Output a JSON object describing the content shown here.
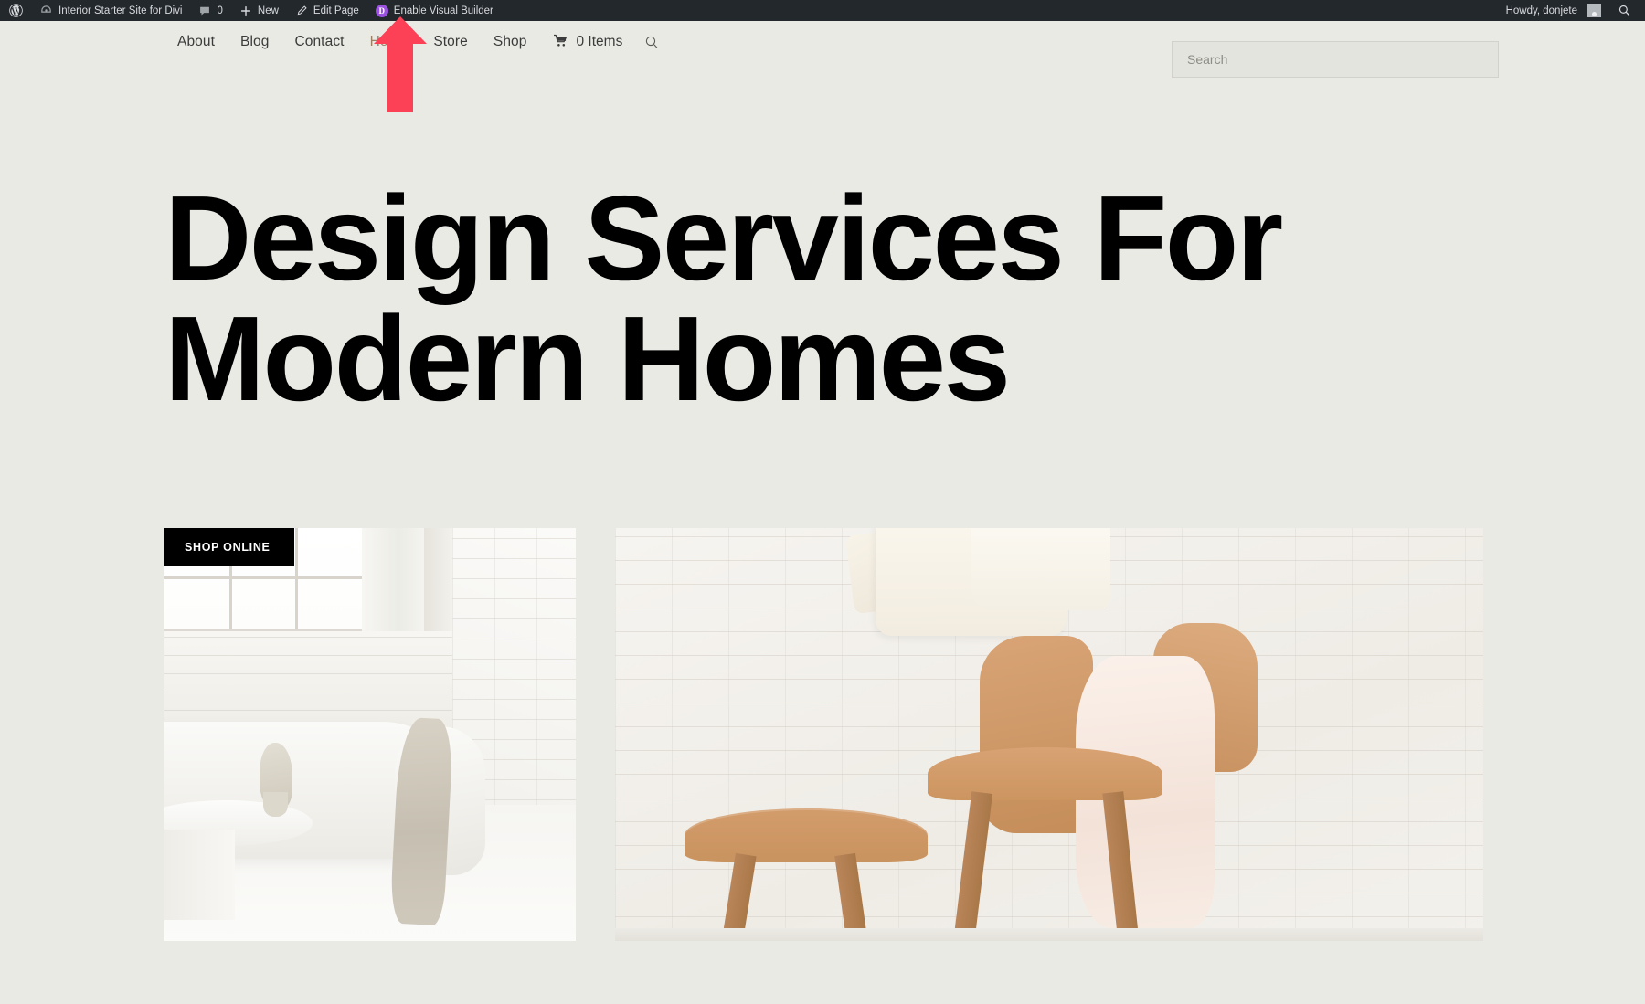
{
  "admin_bar": {
    "items": [
      {
        "icon": "wordpress-logo-icon",
        "label": ""
      },
      {
        "icon": "site-icon",
        "label": "Interior Starter Site for Divi"
      },
      {
        "icon": "comment-icon",
        "label": "0"
      },
      {
        "icon": "plus-icon",
        "label": "New"
      },
      {
        "icon": "pencil-icon",
        "label": "Edit Page"
      },
      {
        "icon": "divi-icon",
        "label": "Enable Visual Builder"
      }
    ],
    "site_title": "Interior Starter Site for Divi",
    "comment_count": "0",
    "new_label": "New",
    "edit_page_label": "Edit Page",
    "visual_builder_label": "Enable Visual Builder",
    "divi_badge_letter": "D",
    "howdy": "Howdy, donjete",
    "search_icon": "search-icon",
    "background_color": "#23282d",
    "divi_accent_color": "#9b51e0"
  },
  "site_nav": {
    "links": [
      {
        "label": "About",
        "active": false
      },
      {
        "label": "Blog",
        "active": false
      },
      {
        "label": "Contact",
        "active": false
      },
      {
        "label": "Home",
        "active": true
      },
      {
        "label": "Store",
        "active": false
      }
    ],
    "shop_label": "Shop",
    "cart_icon": "shopping-cart-icon",
    "cart_items_label": "0 Items",
    "search_toggle_icon": "magnifier-icon",
    "active_color": "#9d7f63",
    "link_color": "#3b3b3b"
  },
  "search": {
    "placeholder": "Search",
    "value": ""
  },
  "hero": {
    "title_line_1": "Design Services For",
    "title_line_2": "Modern Homes",
    "text_color": "#000000"
  },
  "gallery": {
    "badge_label": "SHOP ONLINE",
    "left_image_alt": "White loft interior with curved sofa and marble coffee table",
    "right_image_alt": "Tan leather butterfly chairs against white brick wall"
  },
  "annotation": {
    "type": "arrow-up",
    "color": "#fc4055",
    "points_to": "Enable Visual Builder"
  },
  "page": {
    "background_color": "#eaeae5"
  }
}
